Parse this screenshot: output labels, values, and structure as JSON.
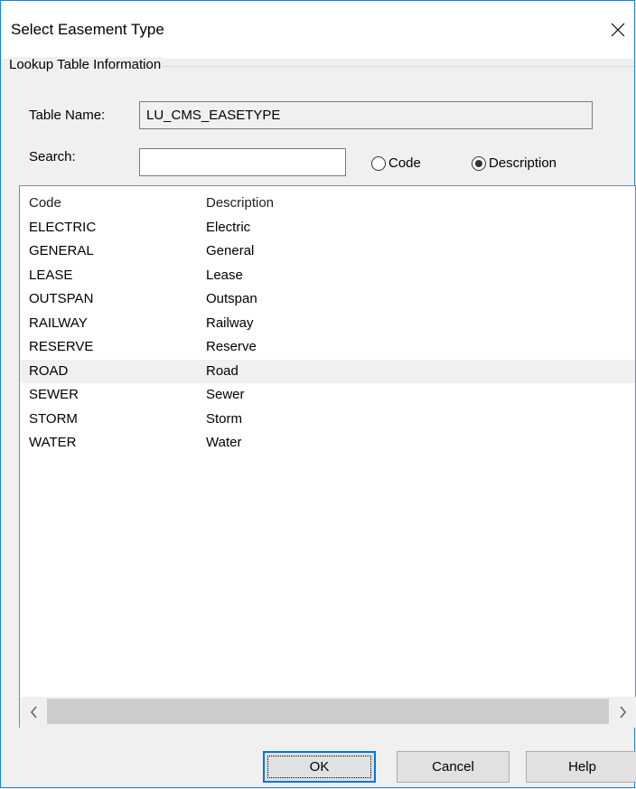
{
  "window": {
    "title": "Select Easement Type"
  },
  "group": {
    "legend": "Lookup Table Information",
    "table_name_label": "Table Name:",
    "table_name_value": "LU_CMS_EASETYPE",
    "search_label": "Search:",
    "search_value": "",
    "search_mode": {
      "code_label": "Code",
      "description_label": "Description",
      "selected": "Description"
    }
  },
  "list": {
    "columns": [
      "Code",
      "Description"
    ],
    "rows": [
      {
        "code": "ELECTRIC",
        "description": "Electric"
      },
      {
        "code": "GENERAL",
        "description": "General"
      },
      {
        "code": "LEASE",
        "description": "Lease"
      },
      {
        "code": "OUTSPAN",
        "description": "Outspan"
      },
      {
        "code": "RAILWAY",
        "description": "Railway"
      },
      {
        "code": "RESERVE",
        "description": "Reserve"
      },
      {
        "code": "ROAD",
        "description": "Road"
      },
      {
        "code": "SEWER",
        "description": "Sewer"
      },
      {
        "code": "STORM",
        "description": "Storm"
      },
      {
        "code": "WATER",
        "description": "Water"
      }
    ],
    "highlighted_row": 6
  },
  "buttons": {
    "ok": "OK",
    "cancel": "Cancel",
    "help": "Help"
  },
  "icons": {
    "close": "close-icon",
    "scroll_left": "chevron-left-icon",
    "scroll_right": "chevron-right-icon"
  },
  "colors": {
    "accent": "#0078d7",
    "window_border": "#1883d7",
    "dialog_bg": "#f0f0f0"
  }
}
